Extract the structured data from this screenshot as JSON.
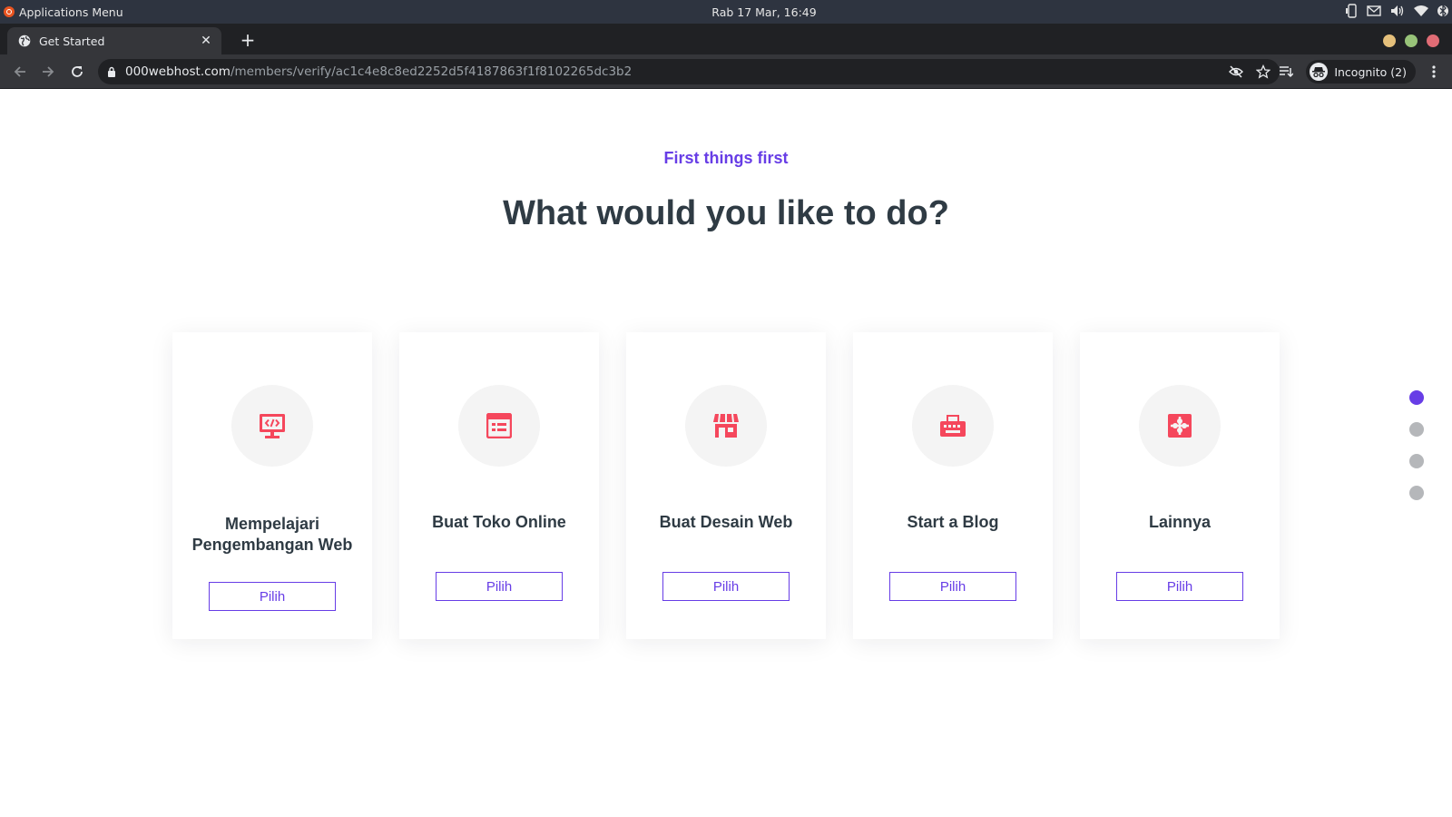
{
  "os": {
    "app_menu_label": "Applications Menu",
    "clock": "Rab 17 Mar, 16:49",
    "tray_icons": [
      "phone-icon",
      "mail-icon",
      "volume-icon",
      "wifi-icon",
      "bluetooth-icon"
    ]
  },
  "browser": {
    "tab_title": "Get Started",
    "url_host": "000webhost.com",
    "url_path": "/members/verify/ac1c4e8c8ed2252d5f4187863f1f8102265dc3b2",
    "incognito_label": "Incognito (2)",
    "window_dot_colors": [
      "#e5c07b",
      "#98c379",
      "#e06c75"
    ]
  },
  "page": {
    "eyebrow": "First things first",
    "headline": "What would you like to do?",
    "accent_color": "#673de6",
    "icon_color": "#f5475c",
    "cards": [
      {
        "title": "Mempelajari Pengembangan Web",
        "button": "Pilih",
        "icon": "code-monitor-icon"
      },
      {
        "title": "Buat Toko Online",
        "button": "Pilih",
        "icon": "web-page-icon"
      },
      {
        "title": "Buat Desain Web",
        "button": "Pilih",
        "icon": "storefront-icon"
      },
      {
        "title": "Start a Blog",
        "button": "Pilih",
        "icon": "typewriter-icon"
      },
      {
        "title": "Lainnya",
        "button": "Pilih",
        "icon": "puzzle-icon"
      }
    ],
    "pager": {
      "total": 4,
      "active": 1
    }
  }
}
